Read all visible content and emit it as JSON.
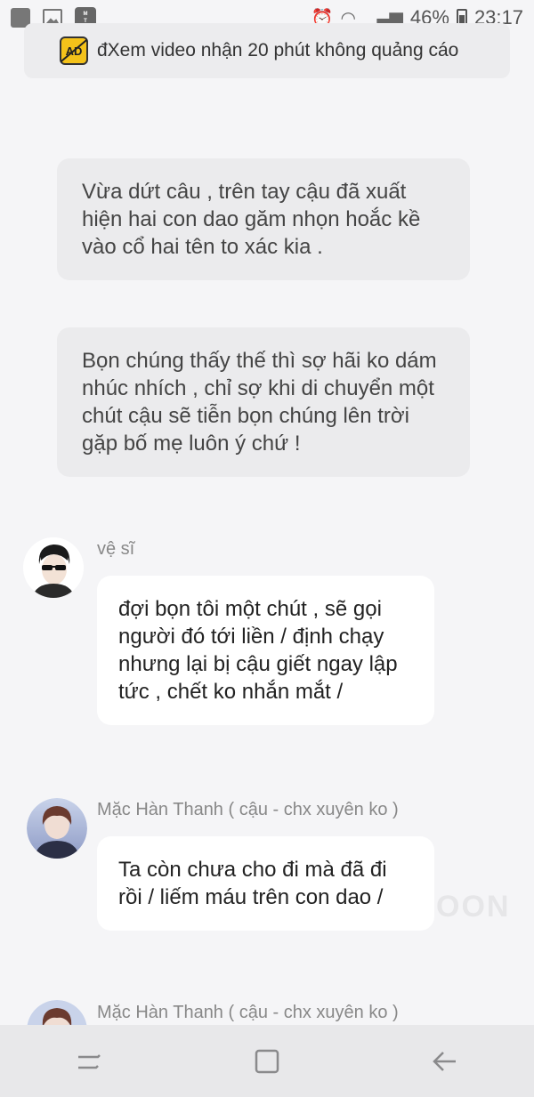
{
  "status_bar": {
    "battery": "46%",
    "time": "23:17"
  },
  "ad_banner": {
    "icon_label": "AD",
    "text": "đXem video nhận 20 phút không quảng cáo"
  },
  "narrations": [
    {
      "text": "Vừa dứt câu , trên tay cậu đã xuất hiện hai con dao găm nhọn hoắc kề vào cổ hai tên to xác kia ."
    },
    {
      "text": "Bọn chúng thấy thế thì sợ hãi ko dám nhúc nhích , chỉ sợ khi di chuyển một chút cậu sẽ tiễn bọn chúng lên trời gặp bố mẹ luôn ý chứ !"
    }
  ],
  "messages": [
    {
      "sender": "vệ sĩ",
      "text": "đợi bọn tôi một chút , sẽ gọi người đó tới liền / định chạy nhưng lại bị cậu giết ngay lập tức , chết ko nhắn mắt /"
    },
    {
      "sender": "Mặc Hàn Thanh ( cậu - chx xuyên ko )",
      "text": "Ta còn chưa cho đi mà đã đi rồi / liếm máu trên con dao /"
    },
    {
      "sender": "Mặc Hàn Thanh ( cậu - chx xuyên ko )"
    }
  ],
  "watermark": "OON",
  "nav_bar": {
    "icons": [
      "recent-apps-icon",
      "home-icon",
      "back-icon"
    ]
  }
}
